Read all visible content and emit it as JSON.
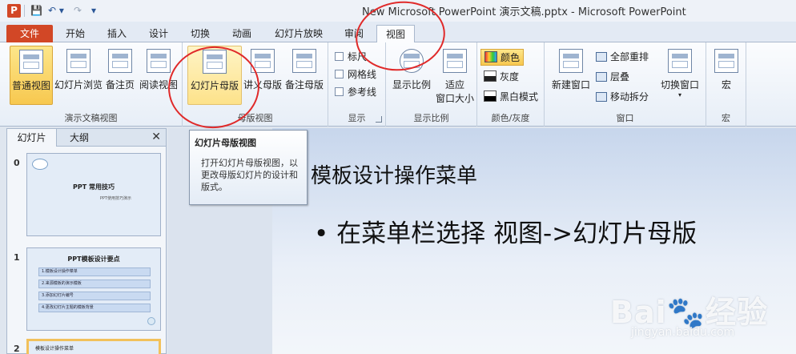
{
  "window": {
    "title": "New Microsoft PowerPoint 演示文稿.pptx - Microsoft PowerPoint",
    "app_letter": "P"
  },
  "quick_access": {
    "save": "💾",
    "undo": "↶ ▾",
    "redo": "↷",
    "customize": "▾"
  },
  "tabs": [
    "文件",
    "开始",
    "插入",
    "设计",
    "切换",
    "动画",
    "幻灯片放映",
    "审阅",
    "视图"
  ],
  "active_tab": "视图",
  "ribbon": {
    "groups": {
      "presentation_views": "演示文稿视图",
      "master_views": "母版视图",
      "show": "显示",
      "zoom": "显示比例",
      "color": "颜色/灰度",
      "window": "窗口",
      "macros": "宏"
    },
    "buttons": {
      "normal": "普通视图",
      "slide_sorter": "幻灯片浏览",
      "notes_page": "备注页",
      "reading_view": "阅读视图",
      "slide_master": "幻灯片母版",
      "handout_master": "讲义母版",
      "notes_master": "备注母版",
      "ruler": "标尺",
      "gridlines": "网格线",
      "guides": "参考线",
      "zoom": "显示比例",
      "fit_window": "适应",
      "fit_window_2": "窗口大小",
      "color": "颜色",
      "grayscale": "灰度",
      "black_white": "黑白模式",
      "new_window": "新建窗口",
      "arrange_all": "全部重排",
      "cascade": "层叠",
      "move_split": "移动拆分",
      "switch_windows": "切换窗口",
      "macros": "宏"
    }
  },
  "tooltip": {
    "title": "幻灯片母版视图",
    "body": "打开幻灯片母版视图，以更改母版幻灯片的设计和版式。"
  },
  "left_panel": {
    "tab_slides": "幻灯片",
    "tab_outline": "大纲",
    "close": "✕",
    "slides": [
      {
        "num": "0",
        "title": "PPT 常用技巧",
        "sub": "PPT使用技巧演示"
      },
      {
        "num": "1",
        "title": "PPT模板设计要点",
        "items": [
          "1.模板设计操作菜单",
          "2.来源模板的演示模板",
          "3.添加幻灯片编号",
          "4.更改幻灯片主题的模板背景"
        ]
      },
      {
        "num": "2",
        "title": "模板设计操作菜单"
      }
    ]
  },
  "slide": {
    "title": "模板设计操作菜单",
    "bullet": "• 在菜单栏选择 视图->幻灯片母版"
  },
  "watermark": {
    "brand": "Bai🐾经验",
    "url": "jingyan.baidu.com"
  }
}
